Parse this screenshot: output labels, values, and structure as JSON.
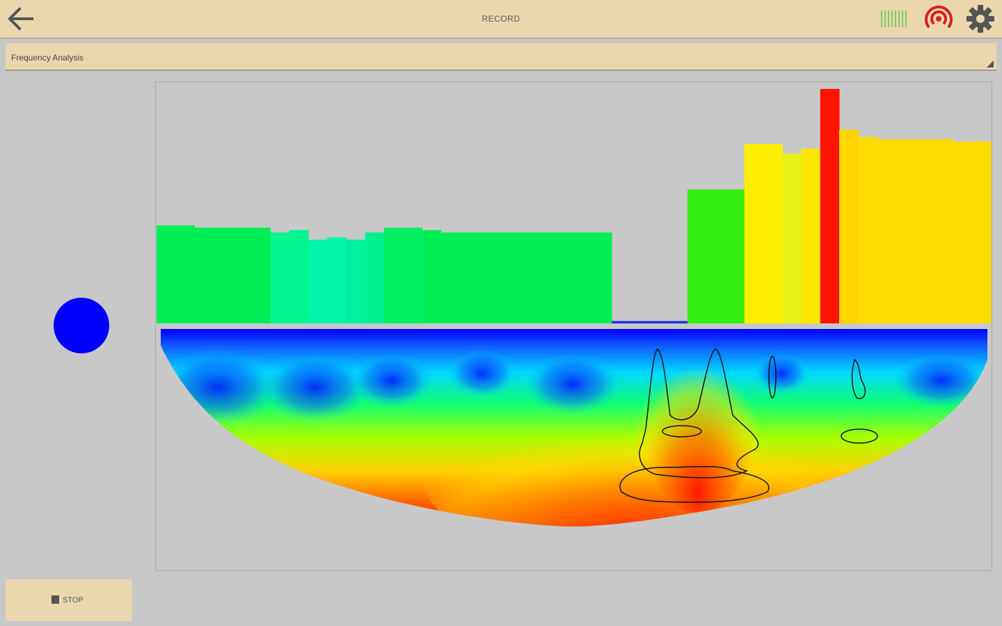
{
  "header": {
    "title": "RECORD",
    "back_icon": "arrow-left-icon",
    "signal_icon": "signal-bars-icon",
    "radar_icon": "radar-icon",
    "settings_icon": "gear-icon"
  },
  "mode_select": {
    "selected": "Frequency Analysis"
  },
  "indicator": {
    "color": "#0000ff"
  },
  "stop_button": {
    "label": "STOP"
  },
  "chart_data": {
    "type": "bar",
    "grid": false,
    "ylim": [
      0,
      100
    ],
    "series": [
      {
        "values": [
          41,
          41,
          40,
          40,
          40,
          40,
          38,
          39,
          35,
          36,
          35,
          38,
          40,
          40,
          39,
          38,
          38,
          38,
          38,
          38,
          38,
          38,
          38,
          38,
          1,
          1,
          1,
          1,
          56,
          56,
          56,
          75,
          75,
          71,
          73,
          98,
          81,
          78,
          77,
          77,
          77,
          77,
          76,
          76
        ]
      }
    ],
    "bar_colors": [
      "#00ee55",
      "#00ee55",
      "#00ee55",
      "#00ee55",
      "#00ee55",
      "#00ee55",
      "#00f590",
      "#00f590",
      "#00f5a8",
      "#00f5a8",
      "#00f0a0",
      "#00f090",
      "#00ee60",
      "#00ee60",
      "#00ee55",
      "#00ee55",
      "#00ee55",
      "#00ee55",
      "#00ee55",
      "#00ee55",
      "#00ee55",
      "#00ee55",
      "#00ee55",
      "#00ee55",
      "#2030e0",
      "#2030e0",
      "#2030e0",
      "#2030e0",
      "#33ee10",
      "#33ee10",
      "#33ee10",
      "#ffee00",
      "#ffee00",
      "#e8f01a",
      "#ffe600",
      "#ff1400",
      "#ffd400",
      "#ffdd00",
      "#ffdd00",
      "#ffdd00",
      "#ffdd00",
      "#ffdd00",
      "#ffdd00",
      "#ffdd00"
    ],
    "scalogram": {
      "colormap": [
        "#0000ff",
        "#00c0ff",
        "#00ff80",
        "#80ff00",
        "#ffff00",
        "#ff8000",
        "#ff0000"
      ],
      "contour_level": 0.82
    }
  }
}
